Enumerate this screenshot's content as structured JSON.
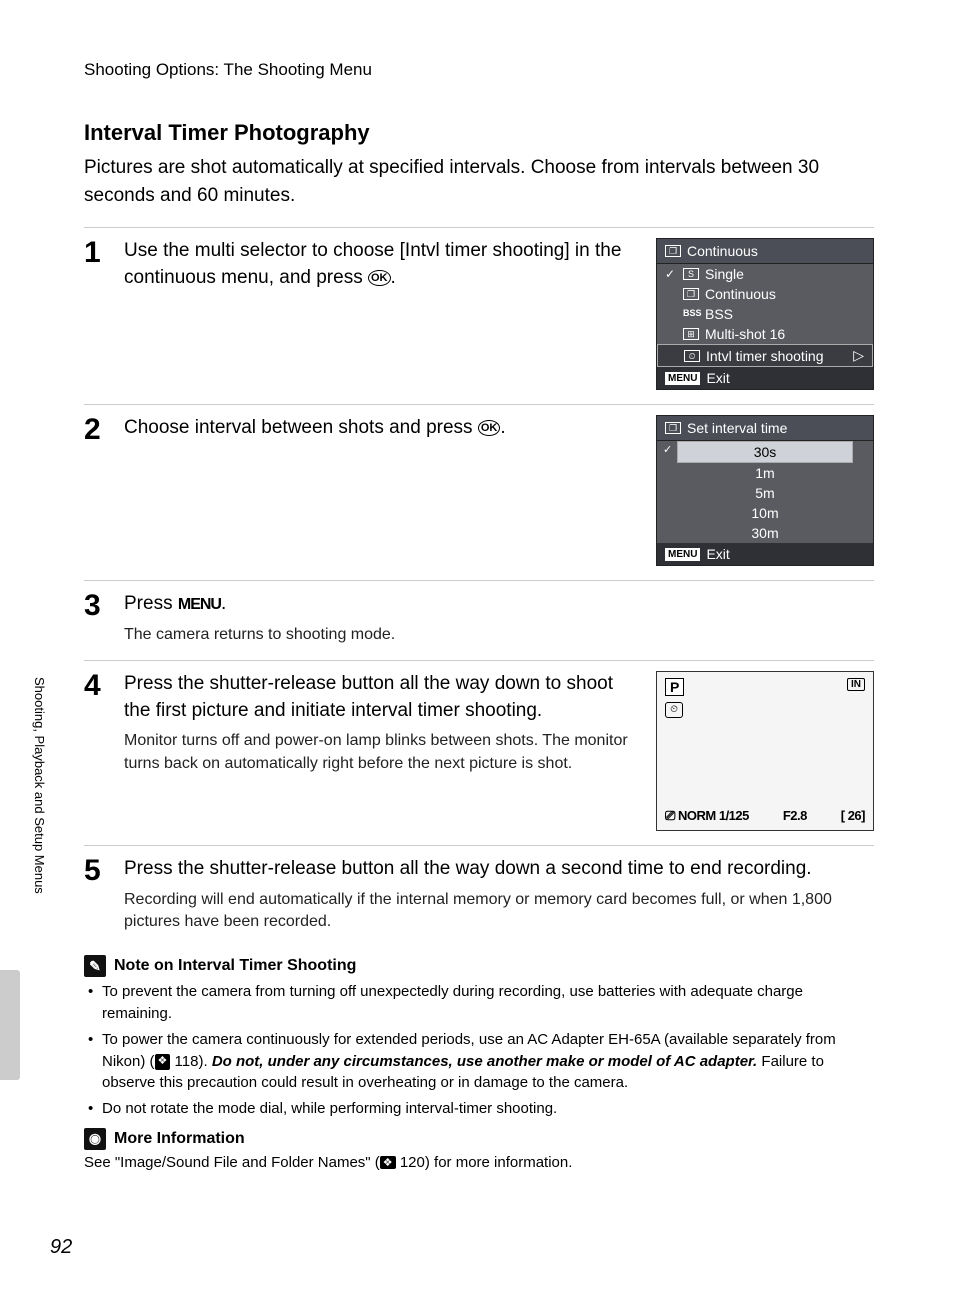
{
  "breadcrumb": "Shooting Options: The Shooting Menu",
  "title": "Interval Timer Photography",
  "intro": "Pictures are shot automatically at specified intervals. Choose from intervals between 30 seconds and 60 minutes.",
  "side_tab": "Shooting, Playback and Setup Menus",
  "page_number": "92",
  "steps": {
    "s1": {
      "num": "1",
      "text_a": "Use the multi selector to choose [Intvl timer shooting] in the continuous menu, and press ",
      "text_b": "."
    },
    "s2": {
      "num": "2",
      "text_a": "Choose interval between shots and press ",
      "text_b": "."
    },
    "s3": {
      "num": "3",
      "text_a": "Press ",
      "text_b": ".",
      "sub": "The camera returns to shooting mode."
    },
    "s4": {
      "num": "4",
      "text": "Press the shutter-release button all the way down to shoot the first picture and initiate interval timer shooting.",
      "sub": "Monitor turns off and power-on lamp blinks between shots. The monitor turns back on automatically right before the next picture is shot."
    },
    "s5": {
      "num": "5",
      "text": "Press the shutter-release button all the way down a second time to end recording.",
      "sub": "Recording will end automatically if the internal memory or memory card becomes full, or when 1,800 pictures have been recorded."
    }
  },
  "screen1": {
    "head": "Continuous",
    "items": [
      "Single",
      "Continuous",
      "BSS",
      "Multi-shot 16",
      "Intvl timer shooting"
    ],
    "foot": "Exit",
    "menu": "MENU"
  },
  "screen2": {
    "head": "Set interval time",
    "items": [
      "30s",
      "1m",
      "5m",
      "10m",
      "30m"
    ],
    "foot": "Exit",
    "menu": "MENU"
  },
  "screen3": {
    "p": "P",
    "in": "IN",
    "bar_left": "⎚ NORM 1/125",
    "bar_mid": "F2.8",
    "bar_right": "[   26]"
  },
  "ok_label": "OK",
  "menu_word": "MENU",
  "notes": {
    "head1": "Note on Interval Timer Shooting",
    "b1": "To prevent the camera from turning off unexpectedly during recording, use batteries with adequate charge remaining.",
    "b2a": "To power the camera continuously for extended periods, use an AC Adapter EH-65A (available separately from Nikon) (",
    "b2ref": " 118). ",
    "b2bold": "Do not, under any circumstances, use another make or model of AC adapter.",
    "b2c": " Failure to observe this precaution could result in overheating or in damage to the camera.",
    "b3": "Do not rotate the mode dial, while performing interval-timer shooting.",
    "head2": "More Information",
    "more_a": "See \"Image/Sound File and Folder Names\" (",
    "more_ref": " 120) for more information."
  },
  "ref_icon": "❖"
}
